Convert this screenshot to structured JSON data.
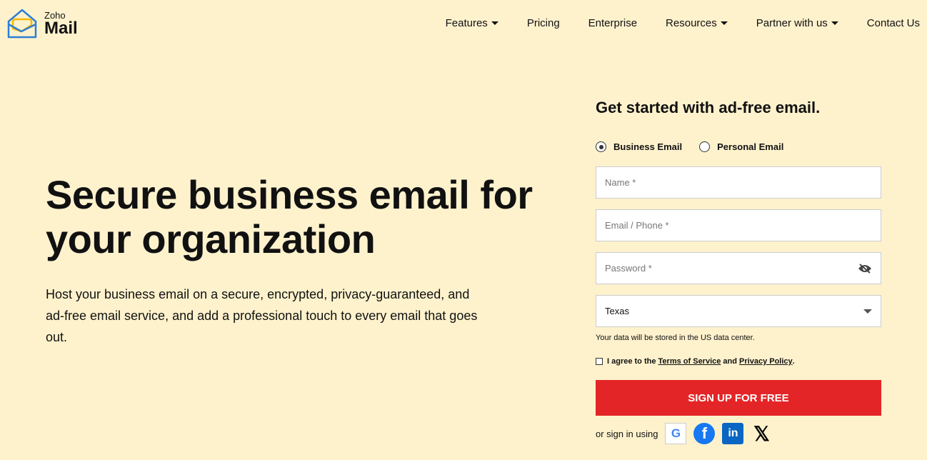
{
  "brand": {
    "top": "Zoho",
    "name": "Mail"
  },
  "nav": [
    {
      "label": "Features",
      "caret": true
    },
    {
      "label": "Pricing",
      "caret": false
    },
    {
      "label": "Enterprise",
      "caret": false
    },
    {
      "label": "Resources",
      "caret": true
    },
    {
      "label": "Partner with us",
      "caret": true
    },
    {
      "label": "Contact Us",
      "caret": false
    }
  ],
  "hero": {
    "title": "Secure business email for your organization",
    "description": "Host your business email on a secure, encrypted, privacy-guaranteed, and ad-free email service, and add a professional touch to every email that goes out."
  },
  "form": {
    "title": "Get started with ad-free email.",
    "radio_business": "Business Email",
    "radio_personal": "Personal Email",
    "selected": "Business Email",
    "name_placeholder": "Name *",
    "email_placeholder": "Email / Phone *",
    "password_placeholder": "Password *",
    "region": "Texas",
    "note": "Your data will be stored in the US data center.",
    "agree_prefix": "I agree to the ",
    "terms": "Terms of Service",
    "and": " and ",
    "privacy": "Privacy Policy",
    "period": ".",
    "submit": "SIGN UP FOR FREE",
    "social_label": "or sign in using",
    "accent": "#e42527"
  }
}
